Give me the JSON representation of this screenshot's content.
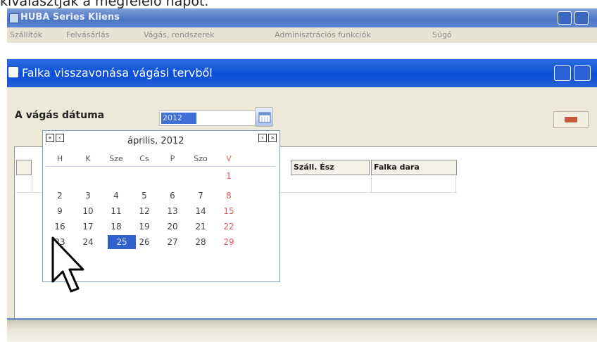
{
  "caption": "kiválasztják a megfelelő napot.",
  "app": {
    "title": "HUBA Series Kliens",
    "menu": [
      "Szállítók",
      "Felvásárlás",
      "Vágás, rendszerek",
      "Adminisztrációs funkciók",
      "Súgó"
    ]
  },
  "dialog": {
    "title": "Falka visszavonása vágási tervből",
    "date_label": "A vágás dátuma",
    "date_value": "2012",
    "right_button_color": "#c75a3c"
  },
  "grid": {
    "columns": [
      "Száll. Ész",
      "Falka dara"
    ]
  },
  "calendar": {
    "month_label": "április, 2012",
    "nav": [
      "«",
      "‹",
      "›",
      "»"
    ],
    "weekdays": [
      "H",
      "K",
      "Sze",
      "Cs",
      "P",
      "Szo",
      "V"
    ],
    "weeks": [
      [
        "",
        "",
        "",
        "",
        "",
        "",
        "1"
      ],
      [
        "2",
        "3",
        "4",
        "5",
        "6",
        "7",
        "8"
      ],
      [
        "9",
        "10",
        "11",
        "12",
        "13",
        "14",
        "15"
      ],
      [
        "16",
        "17",
        "18",
        "19",
        "20",
        "21",
        "22"
      ],
      [
        "23",
        "24",
        "25",
        "26",
        "27",
        "28",
        "29"
      ]
    ],
    "selected_day": "25"
  },
  "colors": {
    "titlebar": "#4b74c4",
    "dialog_title": "#0b4ed6",
    "selection": "#2f62cf",
    "sunday": "#e06060"
  }
}
